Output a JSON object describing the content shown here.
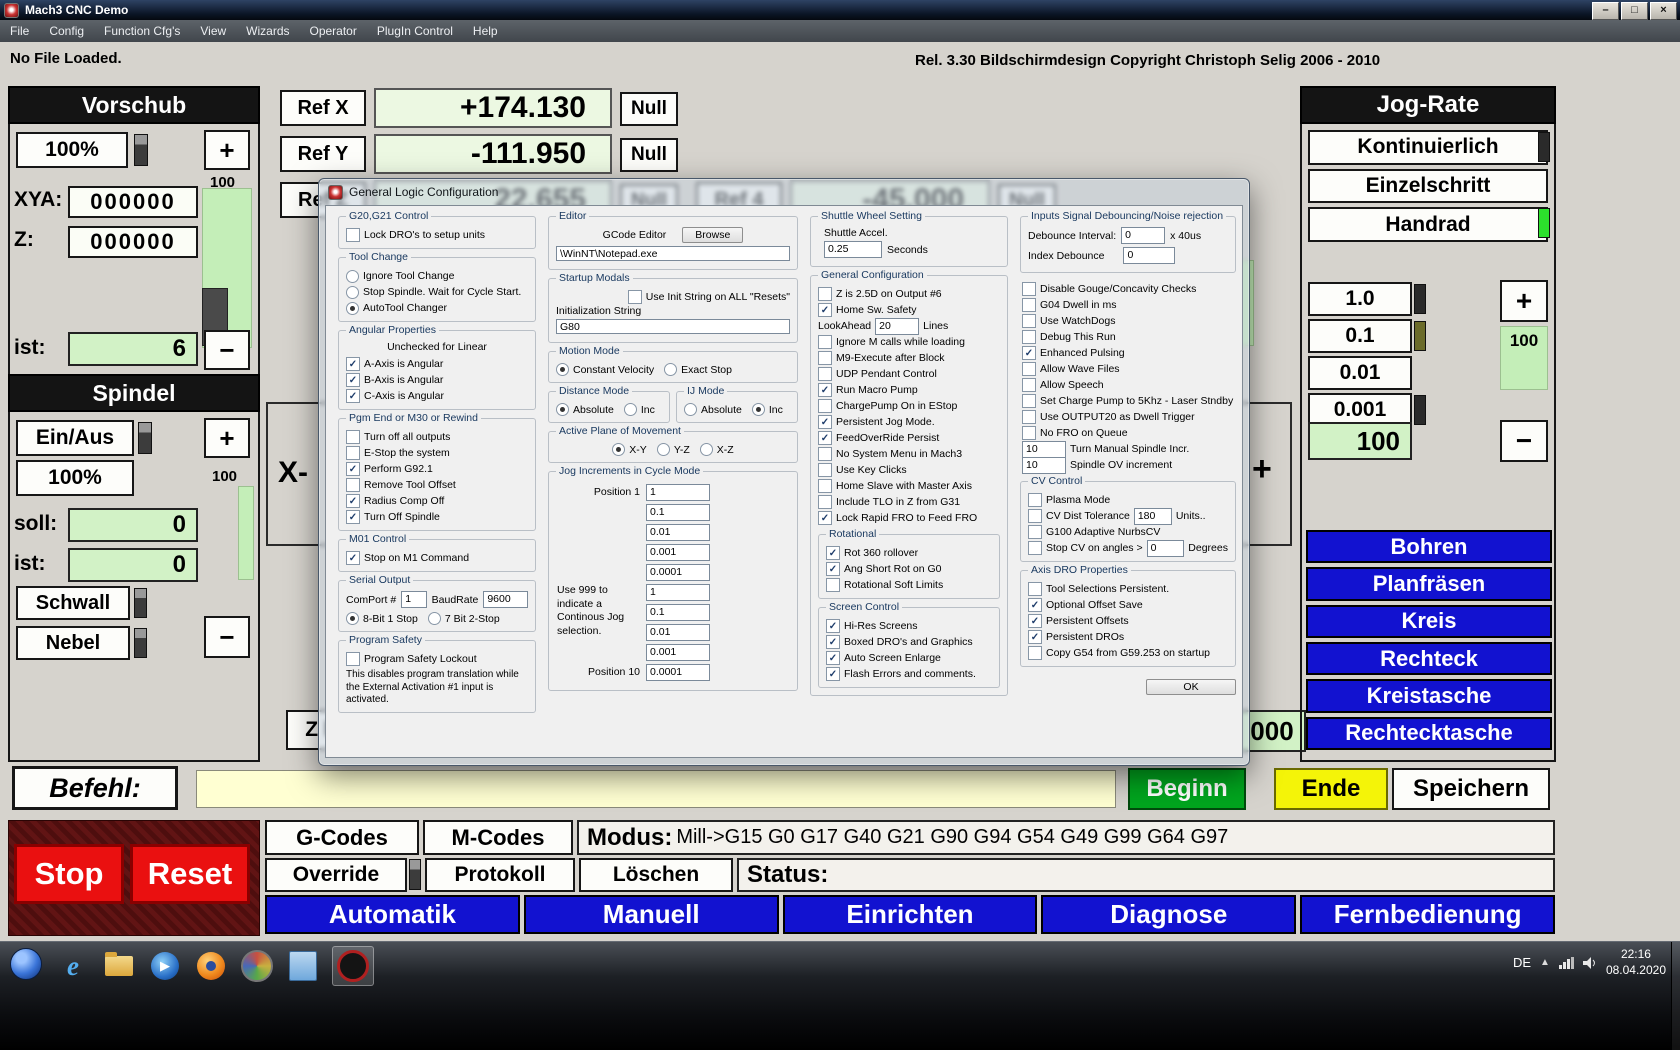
{
  "titlebar": {
    "title": "Mach3 CNC  Demo",
    "minimize": "–",
    "maximize": "□",
    "close": "×"
  },
  "menu": {
    "items": [
      "File",
      "Config",
      "Function Cfg's",
      "View",
      "Wizards",
      "Operator",
      "PlugIn Control",
      "Help"
    ]
  },
  "statusbar": {
    "left": "No File Loaded.",
    "right": "Rel. 3.30 Bildschirmdesign Copyright Christoph Selig 2006 - 2010"
  },
  "vorschub": {
    "title": "Vorschub",
    "pct": "100%",
    "plus": "+",
    "minus": "−",
    "scale": "100",
    "xya_label": "XYA:",
    "xya": "000000",
    "z_label": "Z:",
    "z": "000000",
    "ist_label": "ist:",
    "ist": "6"
  },
  "spindel": {
    "title": "Spindel",
    "einaus": "Ein/Aus",
    "pct": "100%",
    "plus": "+",
    "minus": "−",
    "scale": "100",
    "soll_label": "soll:",
    "soll": "0",
    "ist_label": "ist:",
    "ist": "0",
    "schwall": "Schwall",
    "nebel": "Nebel"
  },
  "dro": {
    "ref_x": "Ref X",
    "x": "+174.130",
    "ref_y": "Ref Y",
    "y": "-111.950",
    "ref_z": "Ref Z",
    "z": "22.655",
    "ref_4": "Ref 4",
    "a": "-45.000",
    "null": "Null",
    "x_axis": "X-",
    "plus": "+",
    "z_partial": "Z h",
    "partial_value": "000"
  },
  "jog": {
    "title": "Jog-Rate",
    "modes": [
      "Kontinuierlich",
      "Einzelschritt",
      "Handrad"
    ],
    "steps": [
      "1.0",
      "0.1",
      "0.01",
      "0.001"
    ],
    "plus": "+",
    "minus": "−",
    "scale": "100",
    "value": "100",
    "cycles": [
      "Bohren",
      "Planfräsen",
      "Kreis",
      "Rechteck",
      "Kreistasche",
      "Rechtecktasche"
    ]
  },
  "command": {
    "label": "Befehl:",
    "value": "",
    "beginn": "Beginn",
    "ende": "Ende",
    "speichern": "Speichern"
  },
  "bottom": {
    "gcodes": "G-Codes",
    "mcodes": "M-Codes",
    "modus_label": "Modus:",
    "modus": "Mill->G15  G0 G17 G40 G21 G90 G94 G54 G49 G99 G64 G97",
    "override": "Override",
    "protokoll": "Protokoll",
    "loeschen": "Löschen",
    "status_label": "Status:",
    "stop": "Stop",
    "reset": "Reset",
    "nav": [
      "Automatik",
      "Manuell",
      "Einrichten",
      "Diagnose",
      "Fernbedienung"
    ]
  },
  "taskbar": {
    "lang": "DE",
    "tray_arrow": "▲",
    "time": "22:16",
    "date": "08.04.2020"
  },
  "dialog": {
    "title": "General Logic Configuration",
    "ok": "OK",
    "g20": {
      "title": "G20,G21 Control",
      "items": [
        {
          "label": "Lock DRO's to setup units",
          "checked": false
        }
      ]
    },
    "tool_change": {
      "title": "Tool Change",
      "options": [
        {
          "label": "Ignore Tool Change",
          "selected": false
        },
        {
          "label": "Stop Spindle. Wait for Cycle Start.",
          "selected": false
        },
        {
          "label": "AutoTool Changer",
          "selected": true
        }
      ]
    },
    "angular": {
      "title": "Angular Properties",
      "note": "Unchecked for Linear",
      "items": [
        {
          "label": "A-Axis is Angular",
          "checked": true
        },
        {
          "label": "B-Axis is Angular",
          "checked": true
        },
        {
          "label": "C-Axis is Angular",
          "checked": true
        }
      ]
    },
    "pgm_end": {
      "title": "Pgm End or M30 or Rewind",
      "items": [
        {
          "label": "Turn off all outputs",
          "checked": false
        },
        {
          "label": "E-Stop the system",
          "checked": false
        },
        {
          "label": "Perform G92.1",
          "checked": true
        },
        {
          "label": "Remove Tool Offset",
          "checked": false
        },
        {
          "label": "Radius Comp Off",
          "checked": true
        },
        {
          "label": "Turn Off Spindle",
          "checked": true
        }
      ]
    },
    "m01": {
      "title": "M01 Control",
      "items": [
        {
          "label": "Stop on M1 Command",
          "checked": true
        }
      ]
    },
    "serial": {
      "title": "Serial Output",
      "comport_label": "ComPort #",
      "comport": "1",
      "baud_label": "BaudRate",
      "baud": "9600",
      "options": [
        {
          "label": "8-Bit 1 Stop",
          "selected": true
        },
        {
          "label": "7 Bit 2-Stop",
          "selected": false
        }
      ]
    },
    "program_safety": {
      "title": "Program Safety",
      "items": [
        {
          "label": "Program Safety Lockout",
          "checked": false
        }
      ],
      "note": "This disables program translation while the External Activation #1 input is activated."
    },
    "editor": {
      "title": "Editor",
      "label": "GCode Editor",
      "browse": "Browse",
      "path": "\\WinNT\\Notepad.exe"
    },
    "startup": {
      "title": "Startup Modals",
      "items": [
        {
          "label": "Use Init String on ALL  \"Resets\"",
          "checked": false
        }
      ],
      "init_label": "Initialization String",
      "init": "G80"
    },
    "motion": {
      "title": "Motion Mode",
      "options": [
        {
          "label": "Constant Velocity",
          "selected": true
        },
        {
          "label": "Exact Stop",
          "selected": false
        }
      ]
    },
    "distance": {
      "title": "Distance Mode",
      "options": [
        {
          "label": "Absolute",
          "selected": true
        },
        {
          "label": "Inc",
          "selected": false
        }
      ]
    },
    "ij": {
      "title": "IJ Mode",
      "options": [
        {
          "label": "Absolute",
          "selected": false
        },
        {
          "label": "Inc",
          "selected": true
        }
      ]
    },
    "plane": {
      "title": "Active Plane of Movement",
      "options": [
        {
          "label": "X-Y",
          "selected": true
        },
        {
          "label": "Y-Z",
          "selected": false
        },
        {
          "label": "X-Z",
          "selected": false
        }
      ]
    },
    "jog_inc": {
      "title": "Jog Increments in Cycle Mode",
      "first_label": "Position 1",
      "last_label": "Position 10",
      "note": "Use 999 to indicate a Continous Jog selection.",
      "values": [
        "1",
        "0.1",
        "0.01",
        "0.001",
        "0.0001",
        "1",
        "0.1",
        "0.01",
        "0.001",
        "0.0001"
      ]
    },
    "shuttle": {
      "title": "Shuttle Wheel Setting",
      "accel_label": "Shuttle Accel.",
      "accel": "0.25",
      "unit": "Seconds"
    },
    "inputs_debounce": {
      "title": "Inputs Signal Debouncing/Noise rejection",
      "debounce_label": "Debounce Interval:",
      "debounce": "0",
      "debounce_unit": "x 40us",
      "index_label": "Index Debounce",
      "index": "0"
    },
    "general": {
      "title": "General Configuration",
      "items": [
        {
          "label": "Z is 2.5D on Output #6",
          "checked": false
        },
        {
          "label": "Home Sw. Safety",
          "checked": true
        },
        {
          "type": "input",
          "pre": "LookAhead",
          "value": "20",
          "post": "Lines"
        },
        {
          "label": "Ignore M calls while loading",
          "checked": false
        },
        {
          "label": "M9-Execute after Block",
          "checked": false
        },
        {
          "label": "UDP Pendant Control",
          "checked": false
        },
        {
          "label": "Run Macro Pump",
          "checked": true
        },
        {
          "label": "ChargePump On in EStop",
          "checked": false
        },
        {
          "label": "Persistent Jog Mode.",
          "checked": true
        },
        {
          "label": "FeedOverRide Persist",
          "checked": true
        },
        {
          "label": "No System Menu in Mach3",
          "checked": false
        },
        {
          "label": "Use Key Clicks",
          "checked": false
        },
        {
          "label": "Home Slave with Master Axis",
          "checked": false
        },
        {
          "label": "Include TLO in Z from G31",
          "checked": false
        },
        {
          "label": "Lock Rapid FRO to Feed FRO",
          "checked": true
        }
      ]
    },
    "rotational": {
      "title": "Rotational",
      "items": [
        {
          "label": "Rot 360 rollover",
          "checked": true
        },
        {
          "label": "Ang Short Rot on G0",
          "checked": true
        },
        {
          "label": "Rotational Soft Limits",
          "checked": false
        }
      ]
    },
    "screen": {
      "title": "Screen Control",
      "items": [
        {
          "label": "Hi-Res Screens",
          "checked": true
        },
        {
          "label": "Boxed DRO's and Graphics",
          "checked": true
        },
        {
          "label": "Auto Screen Enlarge",
          "checked": true
        },
        {
          "label": "Flash Errors and comments.",
          "checked": true
        }
      ]
    },
    "misc": {
      "items": [
        {
          "label": "Disable Gouge/Concavity Checks",
          "checked": false
        },
        {
          "label": "G04 Dwell in ms",
          "checked": false
        },
        {
          "label": "Use WatchDogs",
          "checked": false
        },
        {
          "label": "Debug This Run",
          "checked": false
        },
        {
          "label": "Enhanced Pulsing",
          "checked": true
        },
        {
          "label": "Allow Wave Files",
          "checked": false
        },
        {
          "label": "Allow Speech",
          "checked": false
        },
        {
          "label": "Set Charge Pump to 5Khz - Laser Stndby",
          "checked": false
        },
        {
          "label": "Use OUTPUT20 as Dwell Trigger",
          "checked": false
        },
        {
          "label": "No FRO on Queue",
          "checked": false
        },
        {
          "type": "input",
          "value": "10",
          "post": "Turn Manual Spindle Incr."
        },
        {
          "type": "input",
          "value": "10",
          "post": "Spindle OV increment"
        }
      ]
    },
    "cv": {
      "title": "CV Control",
      "items": [
        {
          "label": "Plasma Mode",
          "checked": false
        },
        {
          "label": "CV Dist Tolerance",
          "checked": false,
          "value": "180",
          "post": "Units.."
        },
        {
          "label": "G100 Adaptive NurbsCV",
          "checked": false
        },
        {
          "label": "Stop CV on angles >",
          "checked": false,
          "value": "0",
          "post": "Degrees"
        }
      ]
    },
    "axis_dro": {
      "title": "Axis DRO Properties",
      "items": [
        {
          "label": "Tool Selections Persistent.",
          "checked": false
        },
        {
          "label": "Optional Offset Save",
          "checked": true
        },
        {
          "label": "Persistent Offsets",
          "checked": true
        },
        {
          "label": "Persistent DROs",
          "checked": true
        },
        {
          "label": "Copy G54 from G59.253 on startup",
          "checked": false
        }
      ]
    }
  }
}
